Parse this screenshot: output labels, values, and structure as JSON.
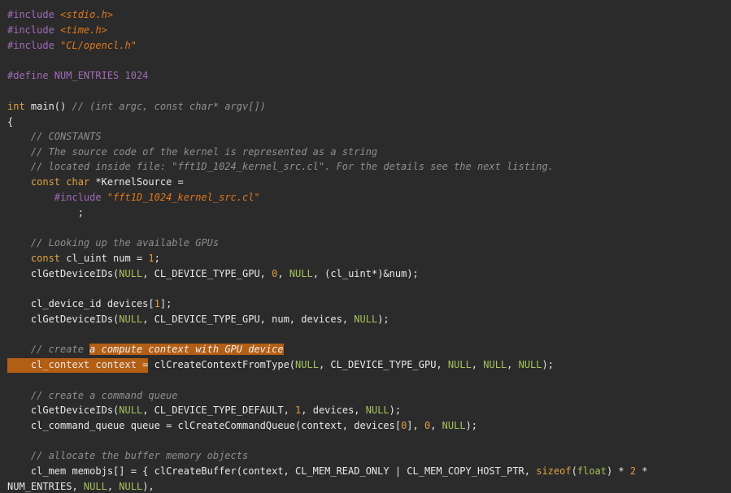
{
  "editor": {
    "lines": [
      {
        "t1": "#include ",
        "t2": "<stdio.h>"
      },
      {
        "t1": "#include ",
        "t2": "<time.h>"
      },
      {
        "t1": "#include ",
        "t2": "\"CL/opencl.h\""
      },
      {
        "t1": "#define NUM_ENTRIES 1024"
      },
      {
        "t1": "int",
        "t2": " main() ",
        "t3": "// (int argc, const char* argv[])"
      },
      {
        "t1": "{"
      },
      {
        "t1": "    // CONSTANTS"
      },
      {
        "t1": "    // The source code of the kernel is represented as a string"
      },
      {
        "t1": "    // located inside file: \"fft1D_1024_kernel_src.cl\". For the details see the next listing."
      },
      {
        "t1": "    ",
        "t2": "const",
        "t3": " ",
        "t4": "char",
        "t5": " *KernelSource ="
      },
      {
        "t1": "        #include ",
        "t2": "\"fft1D_1024_kernel_src.cl\""
      },
      {
        "t1": "            ;"
      },
      {
        "t1": "    // Looking up the available GPUs"
      },
      {
        "t1": "    ",
        "t2": "const",
        "t3": " cl_uint num = ",
        "t4": "1",
        "t5": ";"
      },
      {
        "t1": "    clGetDeviceIDs(",
        "t2": "NULL",
        "t3": ", CL_DEVICE_TYPE_GPU, ",
        "t4": "0",
        "t5": ", ",
        "t6": "NULL",
        "t7": ", (cl_uint*)&num);"
      },
      {
        "t1": "    cl_device_id devices[",
        "t2": "1",
        "t3": "];"
      },
      {
        "t1": "    clGetDeviceIDs(",
        "t2": "NULL",
        "t3": ", CL_DEVICE_TYPE_GPU, num, devices, ",
        "t4": "NULL",
        "t5": ");"
      },
      {
        "t1": "    // create ",
        "t2": "a compute context with GPU device"
      },
      {
        "t1": "    cl_context context",
        "t2": " = clCreateContextFromType(",
        "t3": "NULL",
        "t4": ", CL_DEVICE_TYPE_GPU, ",
        "t5": "NULL",
        "t6": ", ",
        "t7": "NULL",
        "t8": ", ",
        "t9": "NULL",
        "t10": ");"
      },
      {
        "t1": "    // create a command queue"
      },
      {
        "t1": "    clGetDeviceIDs(",
        "t2": "NULL",
        "t3": ", CL_DEVICE_TYPE_DEFAULT, ",
        "t4": "1",
        "t5": ", devices, ",
        "t6": "NULL",
        "t7": ");"
      },
      {
        "t1": "    cl_command_queue queue = clCreateCommandQueue(context, devices[",
        "t2": "0",
        "t3": "], ",
        "t4": "0",
        "t5": ", ",
        "t6": "NULL",
        "t7": ");"
      },
      {
        "t1": "    // allocate the buffer memory objects"
      },
      {
        "t1": "    cl_mem memobjs[] = { clCreateBuffer(context, CL_MEM_READ_ONLY | CL_MEM_COPY_HOST_PTR, ",
        "t2": "sizeof",
        "t3": "(",
        "t4": "float",
        "t5": ") * ",
        "t6": "2",
        "t7": " *"
      },
      {
        "t1": "NUM_ENTRIES, ",
        "t2": "NULL",
        "t3": ", ",
        "t4": "NULL",
        "t5": "),"
      }
    ]
  }
}
